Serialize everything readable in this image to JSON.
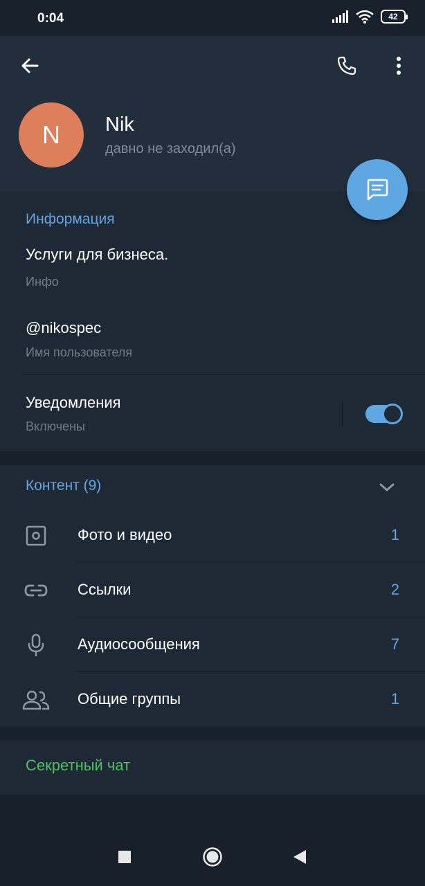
{
  "status_bar": {
    "time": "0:04",
    "battery": "42"
  },
  "header": {
    "back_icon": "arrow-left-icon",
    "call_icon": "phone-icon",
    "more_icon": "more-vertical-icon",
    "avatar_letter": "N",
    "avatar_color": "#de7e5b",
    "name": "Nik",
    "status": "давно не заходил(а)",
    "fab_icon": "message-icon"
  },
  "info": {
    "title": "Информация",
    "bio": "Услуги для бизнеса.",
    "bio_caption": "Инфо",
    "username": "@nikospec",
    "username_caption": "Имя пользователя",
    "notifications": "Уведомления",
    "notifications_caption": "Включены",
    "notifications_enabled": true
  },
  "content": {
    "title": "Контент (9)",
    "items": [
      {
        "icon": "photo-icon",
        "label": "Фото и видео",
        "count": "1"
      },
      {
        "icon": "link-icon",
        "label": "Ссылки",
        "count": "2"
      },
      {
        "icon": "microphone-icon",
        "label": "Аудиосообщения",
        "count": "7"
      },
      {
        "icon": "groups-icon",
        "label": "Общие группы",
        "count": "1"
      }
    ]
  },
  "secret_chat": {
    "label": "Секретный чат",
    "color": "#4fc05f"
  },
  "colors": {
    "accent": "#5ea7e3",
    "header_bg": "#222e3c",
    "section_bg": "#1f2936"
  }
}
